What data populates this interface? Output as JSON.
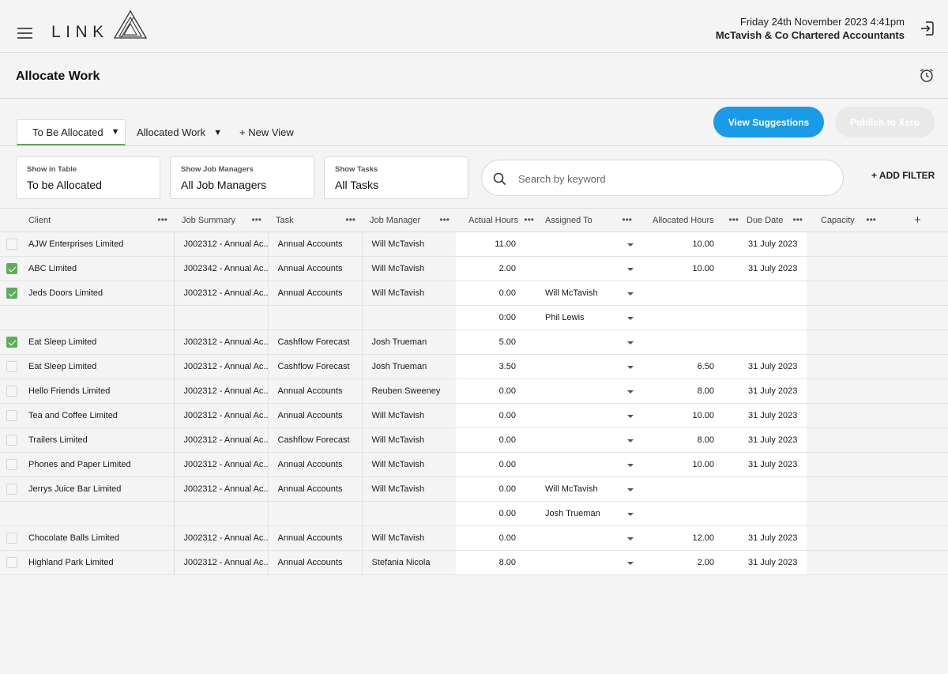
{
  "header": {
    "logo_text": "LINK",
    "date": "Friday 24th November 2023  4:41pm",
    "firm": "McTavish & Co Chartered Accountants"
  },
  "page": {
    "title": "Allocate Work"
  },
  "tabs": [
    {
      "label": "To Be Allocated",
      "caret": "▼",
      "active": true
    },
    {
      "label": "Allocated Work",
      "caret": "▼",
      "active": false
    },
    {
      "label": "+ New View",
      "active": false
    }
  ],
  "actions": {
    "view_suggestions": "View Suggestions",
    "publish": "Publish to Xero"
  },
  "filters": [
    {
      "label": "Show in Table",
      "value": "To be Allocated"
    },
    {
      "label": "Show Job Managers",
      "value": "All Job Managers"
    },
    {
      "label": "Show Tasks",
      "value": "All Tasks"
    }
  ],
  "search": {
    "placeholder": "Search by keyword"
  },
  "add_filter": "+ ADD FILTER",
  "table": {
    "columns": [
      "Client",
      "Job Summary",
      "Task",
      "Job Manager",
      "Actual Hours",
      "Assigned To",
      "Allocated Hours",
      "Due Date",
      "Capacity"
    ],
    "menu_glyph": "•••",
    "add_column": "+",
    "rows": [
      {
        "checked": false,
        "client": "AJW Enterprises Limited",
        "summary": "J002312 - Annual Ac..",
        "task": "Annual Accounts",
        "manager": "Will McTavish",
        "actual": "11.00",
        "assigned": "",
        "allocated": "10.00",
        "due": "31 July 2023"
      },
      {
        "checked": true,
        "client": "ABC Limited",
        "summary": "J002342 - Annual Ac..",
        "task": "Annual Accounts",
        "manager": "Will McTavish",
        "actual": "2.00",
        "assigned": "",
        "allocated": "10.00",
        "due": "31 July 2023"
      },
      {
        "checked": true,
        "client": "Jeds Doors Limited",
        "summary": "J002312 - Annual Ac..",
        "task": "Annual Accounts",
        "manager": "Will McTavish",
        "actual": "0.00",
        "assigned": "Will McTavish",
        "allocated": "",
        "due": ""
      },
      {
        "sub": true,
        "actual": "0:00",
        "assigned": "Phil Lewis",
        "allocated": "",
        "due": ""
      },
      {
        "checked": true,
        "client": "Eat Sleep Limited",
        "summary": "J002312 - Annual Ac..",
        "task": "Cashflow Forecast",
        "manager": "Josh Trueman",
        "actual": "5.00",
        "assigned": "",
        "allocated": "",
        "due": ""
      },
      {
        "checked": false,
        "client": "Eat Sleep Limited",
        "summary": "J002312 - Annual Ac..",
        "task": "Cashflow Forecast",
        "manager": "Josh Trueman",
        "actual": "3.50",
        "assigned": "",
        "allocated": "6.50",
        "due": "31 July 2023"
      },
      {
        "checked": false,
        "client": "Hello Friends Limited",
        "summary": "J002312 - Annual Ac..",
        "task": "Annual Accounts",
        "manager": "Reuben Sweeney",
        "actual": "0.00",
        "assigned": "",
        "allocated": "8.00",
        "due": "31 July 2023"
      },
      {
        "checked": false,
        "client": "Tea and Coffee Limited",
        "summary": "J002312 - Annual Ac..",
        "task": "Annual Accounts",
        "manager": "Will McTavish",
        "actual": "0.00",
        "assigned": "",
        "allocated": "10.00",
        "due": "31 July 2023"
      },
      {
        "checked": false,
        "client": "Trailers Limited",
        "summary": "J002312 - Annual Ac..",
        "task": "Cashflow Forecast",
        "manager": "Will McTavish",
        "actual": "0.00",
        "assigned": "",
        "allocated": "8.00",
        "due": "31 July 2023"
      },
      {
        "checked": false,
        "client": "Phones and Paper Limited",
        "summary": "J002312 - Annual Ac..",
        "task": "Annual Accounts",
        "manager": "Will McTavish",
        "actual": "0.00",
        "assigned": "",
        "allocated": "10.00",
        "due": "31 July 2023"
      },
      {
        "checked": false,
        "client": "Jerrys Juice Bar Limited",
        "summary": "J002312 - Annual Ac..",
        "task": "Annual Accounts",
        "manager": "Will McTavish",
        "actual": "0.00",
        "assigned": "Will McTavish",
        "allocated": "",
        "due": ""
      },
      {
        "sub": true,
        "actual": "0.00",
        "assigned": "Josh Trueman",
        "allocated": "",
        "due": ""
      },
      {
        "checked": false,
        "client": "Chocolate Balls Limited",
        "summary": "J002312 - Annual Ac..",
        "task": "Annual Accounts",
        "manager": "Will McTavish",
        "actual": "0.00",
        "assigned": "",
        "allocated": "12.00",
        "due": "31 July 2023"
      },
      {
        "checked": false,
        "client": "Highland Park Limited",
        "summary": "J002312 - Annual Ac..",
        "task": "Annual Accounts",
        "manager": "Stefania Nicola",
        "actual": "8.00",
        "assigned": "",
        "allocated": "2.00",
        "due": "31 July 2023"
      }
    ]
  },
  "colors": {
    "accent_blue": "#1a9be8",
    "check_green": "#5cae57",
    "background": "#f4f4f4"
  },
  "icons": {
    "menu": "hamburger-icon",
    "logo": "triangle-logo-icon",
    "logout": "logout-icon",
    "alarm": "alarm-clock-icon",
    "search": "search-icon",
    "dropdown": "caret-down-icon"
  }
}
